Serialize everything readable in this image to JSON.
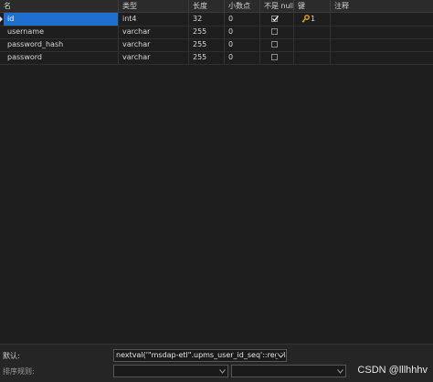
{
  "table": {
    "columns": [
      "名",
      "类型",
      "长度",
      "小数点",
      "不是 null",
      "键",
      "注释"
    ],
    "rows": [
      {
        "name": "id",
        "type": "int4",
        "length": "32",
        "decimal": "0",
        "not_null": true,
        "key": "1",
        "comment": ""
      },
      {
        "name": "username",
        "type": "varchar",
        "length": "255",
        "decimal": "0",
        "not_null": false,
        "key": "",
        "comment": ""
      },
      {
        "name": "password_hash",
        "type": "varchar",
        "length": "255",
        "decimal": "0",
        "not_null": false,
        "key": "",
        "comment": ""
      },
      {
        "name": "password",
        "type": "varchar",
        "length": "255",
        "decimal": "0",
        "not_null": false,
        "key": "",
        "comment": ""
      }
    ]
  },
  "properties": {
    "default_label": "默认:",
    "default_value": "nextval('\"msdap-etl\".upms_user_id_seq'::regclass",
    "collation_label": "排序规则:"
  },
  "watermark": "CSDN @lllhhhv",
  "colors": {
    "selection": "#1f6fd0",
    "background": "#1e1e1e",
    "key_icon": "#e8a317"
  }
}
